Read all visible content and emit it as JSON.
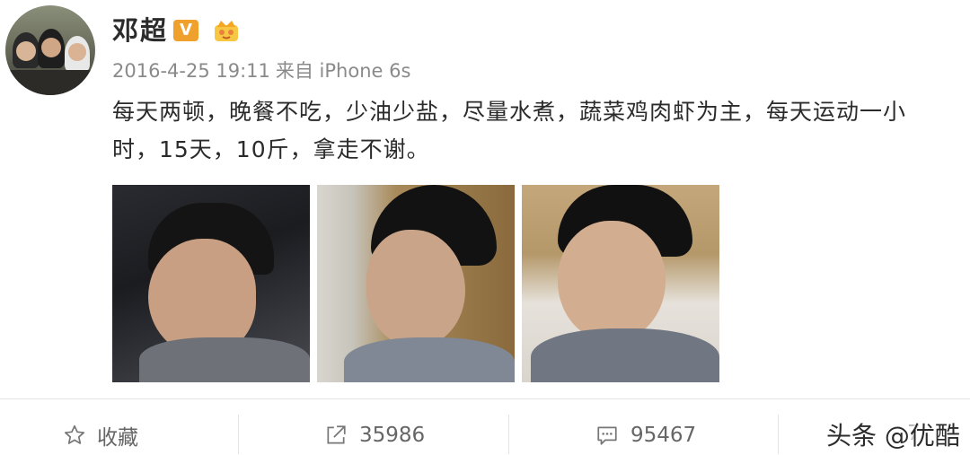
{
  "post": {
    "author_name": "邓超",
    "verified_badge": "V",
    "badge_icon": "crown-badge-icon",
    "timestamp": "2016-4-25 19:11",
    "source": "来自 iPhone 6s",
    "text": "每天两顿，晚餐不吃，少油少盐，尽量水煮，蔬菜鸡肉虾为主，每天运动一小时，15天，10斤，拿走不谢。",
    "photos": [
      "photo-1",
      "photo-2",
      "photo-3"
    ]
  },
  "actions": {
    "favorite_label": "收藏",
    "share_count": "35986",
    "comment_count": "95467",
    "like_count": "7"
  },
  "watermark": "头条 @优酷",
  "colors": {
    "verified_badge": "#f0a02d",
    "text": "#2b2b2b",
    "meta": "#8a8a8a",
    "divider": "#e4e4e4"
  }
}
